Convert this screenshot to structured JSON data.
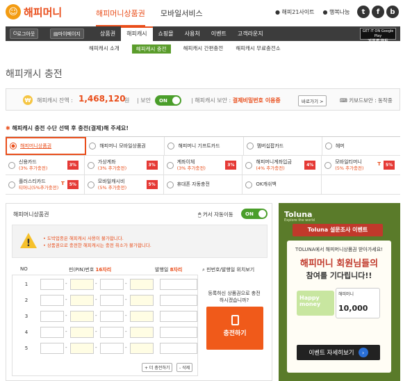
{
  "header": {
    "logo_text": "해피머니",
    "nav": [
      "해피머니상품권",
      "모바일서비스"
    ],
    "links": [
      "해피21사이트",
      "행복나눔"
    ],
    "sns": [
      "t",
      "f",
      "b"
    ]
  },
  "gnb": {
    "logout": "로그아웃",
    "mypage": "마이페이지",
    "menu": [
      "상품권",
      "해피캐시",
      "쇼핑몰",
      "사용처",
      "이벤트",
      "고객라운지"
    ],
    "gplay_line1": "GET IT ON Google Play",
    "gplay_line2": "기프트코드"
  },
  "subnav": [
    "해피캐시 소개",
    "해피캐시 충전",
    "해피캐시 간편충전",
    "해피캐시 무료충전소"
  ],
  "page_title": "해피캐시 충전",
  "balance": {
    "coin": "₩",
    "label": "해피캐시 잔액 :",
    "value": "1,468,120",
    "unit": "원",
    "security_label": "보안",
    "toggle": "ON",
    "security2_label": "해피캐시 보안 :",
    "security2_value": "결제비밀번호 이용중",
    "detail_button": "바로가기 >",
    "keyboard": "키보드보안 : 동작중"
  },
  "select_header": "해피캐시 충전 수단 선택 후 충전(결제)해 주세요!",
  "methods": [
    [
      {
        "label": "해피머니상품권",
        "selected": true
      },
      {
        "label": "해피머니 모바일상품권"
      },
      {
        "label": "해피머니 기프트카드"
      },
      {
        "label": "멤버십팝카드"
      },
      {
        "label": "헤머"
      }
    ],
    [
      {
        "label": "신용카드",
        "sub": "(3% 추가충전)",
        "pct": "3%"
      },
      {
        "label": "가상계좌",
        "sub": "(3% 추가충전)",
        "pct": "3%"
      },
      {
        "label": "계좌이체",
        "sub": "(3% 추가충전)",
        "pct": "3%"
      },
      {
        "label": "해피머니계좌입금",
        "sub": "(4% 추가충전)",
        "pct": "4%"
      },
      {
        "label": "모바일티머니",
        "sub": "(5% 추가충전)",
        "pct": "5%",
        "mark": "T"
      }
    ],
    [
      {
        "label": "플러스티카드",
        "sub": "티머니(5%추가충전)",
        "pct": "5%",
        "mark": "T"
      },
      {
        "label": "모바일캐시비",
        "sub": "(5% 추가충전)",
        "pct": "5%"
      },
      {
        "label": "휴대폰 자동충전"
      },
      {
        "label": "OK캐쉬백"
      }
    ]
  ],
  "panel": {
    "title": "해피머니상품권",
    "cursor_label": "커서 자동이동",
    "toggle": "ON",
    "notice_lines": [
      "• 도박업종은 해피캐시 사용이 불가합니다.",
      "• 상품권으로 충전한 해피캐시는 충전 취소가 불가합니다."
    ],
    "col_no": "NO",
    "col_pin": "핀(PIN)번호",
    "col_pin_len": "16자리",
    "col_date": "발행일",
    "col_date_len": "8자리",
    "col_search": "핀번호/발행일 위치보기",
    "rows": [
      "1",
      "2",
      "3",
      "4",
      "5"
    ],
    "add_button": "+ 더 충전하기",
    "delete_button": "- 삭제",
    "ask_text": "등록하신 상품권으로 충전하시겠습니까?",
    "charge_button": "충전하기"
  },
  "ad": {
    "brand": "Toluna",
    "tagline": "Explore the world",
    "ribbon": "Toluna 설문조사 이벤트",
    "line1": "TOLUNA에서 해피머니상품권 받아가세요!",
    "line2": "해피머니 회원님들의",
    "line3": "참여를 기다립니다!!",
    "card1": "Happy money",
    "card2_brand": "해피머니",
    "card2_amount": "10,000",
    "event_button": "이벤트 자세히보기",
    "event_arrow": "›"
  }
}
